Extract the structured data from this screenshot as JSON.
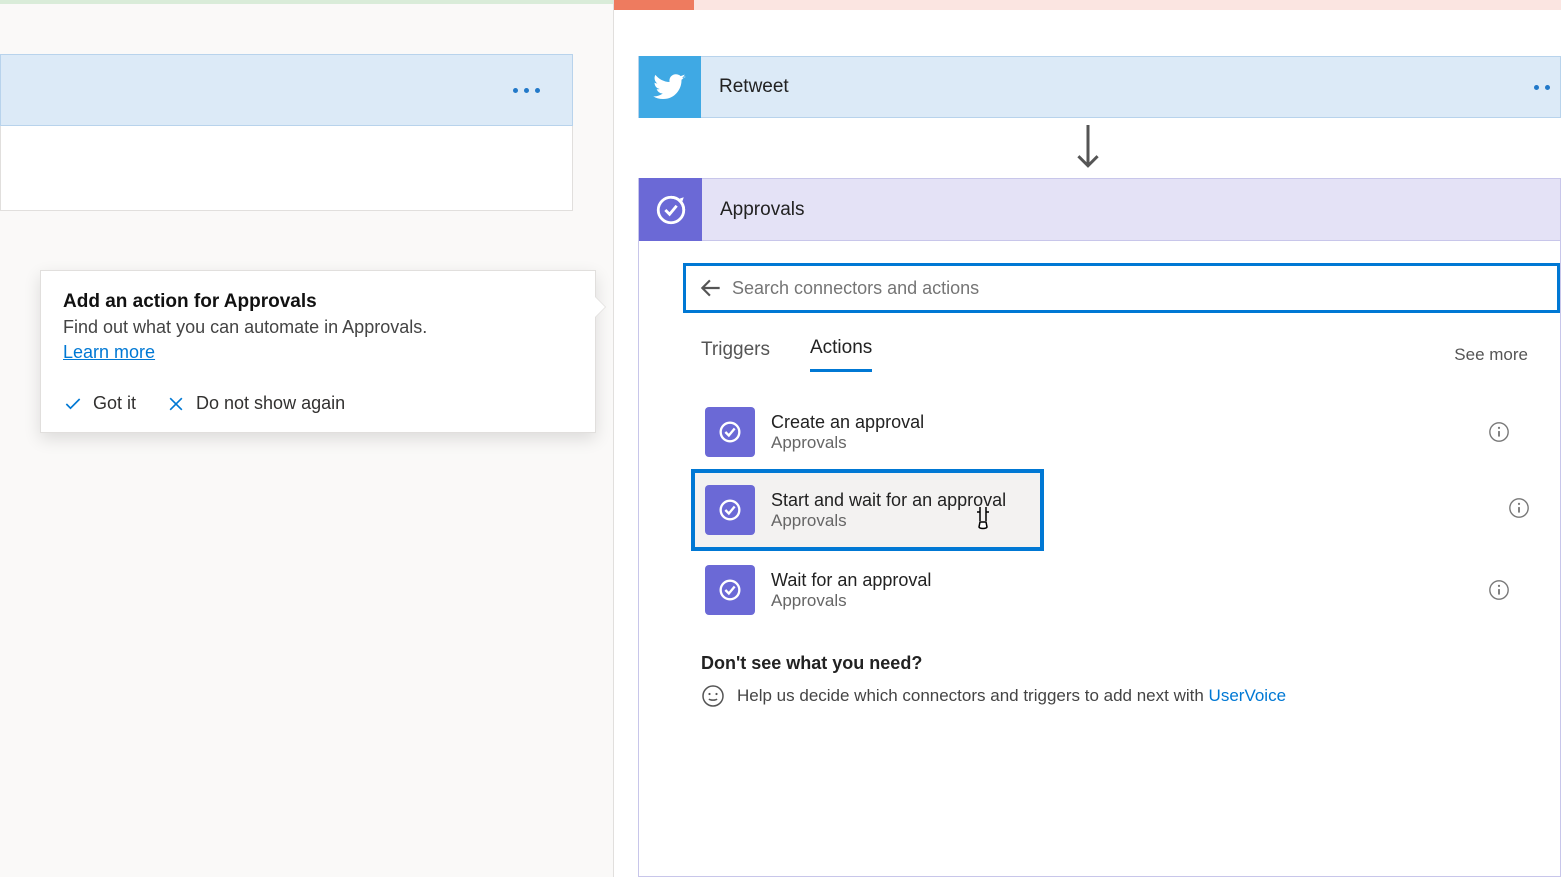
{
  "callout": {
    "title": "Add an action for Approvals",
    "desc": "Find out what you can automate in Approvals.",
    "link": "Learn more",
    "gotit": "Got it",
    "donotshow": "Do not show again"
  },
  "retweet": {
    "label": "Retweet"
  },
  "approvals": {
    "label": "Approvals"
  },
  "search": {
    "placeholder": "Search connectors and actions"
  },
  "tabs": {
    "triggers": "Triggers",
    "actions": "Actions",
    "seemore": "See more"
  },
  "actions": [
    {
      "title": "Create an approval",
      "sub": "Approvals"
    },
    {
      "title": "Start and wait for an approval",
      "sub": "Approvals"
    },
    {
      "title": "Wait for an approval",
      "sub": "Approvals"
    }
  ],
  "help": {
    "title": "Don't see what you need?",
    "text": "Help us decide which connectors and triggers to add next with ",
    "link": "UserVoice"
  }
}
